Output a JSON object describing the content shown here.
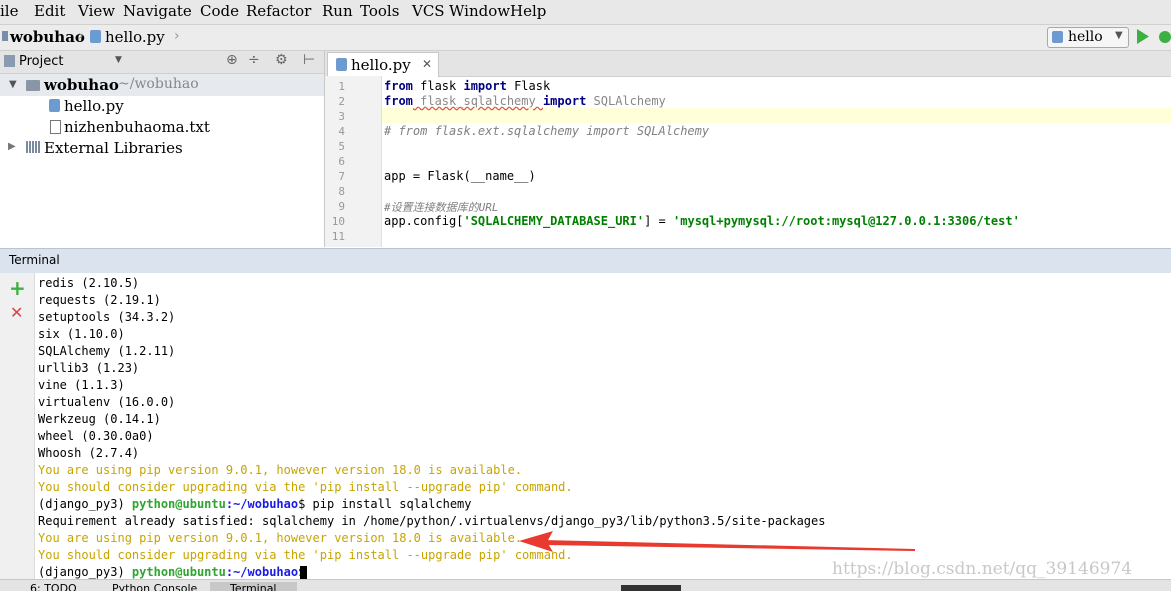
{
  "menu": [
    "ile",
    "Edit",
    "View",
    "Navigate",
    "Code",
    "Refactor",
    "Run",
    "Tools",
    "VCS",
    "Window",
    "Help"
  ],
  "nav": {
    "project": "wobuhao",
    "file": "hello.py",
    "run_config": "hello"
  },
  "project_panel": {
    "title": "Project",
    "root_name": "wobuhao",
    "root_path": "~/wobuhao",
    "files": [
      "hello.py",
      "nizhenbuhaoma.txt"
    ],
    "external": "External Libraries"
  },
  "editor": {
    "tab": "hello.py",
    "line_numbers": [
      "1",
      "2",
      "3",
      "4",
      "5",
      "6",
      "7",
      "8",
      "9",
      "10",
      "11"
    ],
    "lines": {
      "l1_kw1": "from",
      "l1_mod": " flask ",
      "l1_kw2": "import",
      "l1_name": " Flask",
      "l2_kw1": "from",
      "l2_mod": " flask_sqlalchemy ",
      "l2_kw2": "import",
      "l2_name": " SQLAlchemy",
      "l4": "# from flask.ext.sqlalchemy import SQLAlchemy",
      "l7": "app = Flask(__name__)",
      "l9": "#设置连接数据库的URL",
      "l10_a": "app.config[",
      "l10_key": "'SQLALCHEMY_DATABASE_URI'",
      "l10_b": "] = ",
      "l10_val": "'mysql+pymysql://root:mysql@127.0.0.1:3306/test'"
    }
  },
  "terminal": {
    "title": "Terminal",
    "packages": [
      "redis (2.10.5)",
      "requests (2.19.1)",
      "setuptools (34.3.2)",
      "six (1.10.0)",
      "SQLAlchemy (1.2.11)",
      "urllib3 (1.23)",
      "vine (1.1.3)",
      "virtualenv (16.0.0)",
      "Werkzeug (0.14.1)",
      "wheel (0.30.0a0)",
      "Whoosh (2.7.4)"
    ],
    "warn1": "You are using pip version 9.0.1, however version 18.0 is available.",
    "warn2": "You should consider upgrading via the 'pip install --upgrade pip' command.",
    "prompt_env": "(django_py3) ",
    "prompt_user": "python@ubuntu",
    "prompt_path": ":~/wobuhao",
    "prompt_dollar": "$ ",
    "command": "pip install sqlalchemy",
    "satisfied": "Requirement already satisfied: sqlalchemy in /home/python/.virtualenvs/django_py3/lib/python3.5/site-packages",
    "warn3": "You are using pip version 9.0.1, however version 18.0 is available.",
    "warn4": "You should consider upgrading via the 'pip install --upgrade pip' command."
  },
  "bottom_tabs": [
    "6: TODO",
    "Python Console",
    "Terminal"
  ],
  "watermark": "https://blog.csdn.net/qq_39146974",
  "colors": {
    "warning_text": "#c7a400",
    "arrow": "#e83a2e",
    "prompt_user": "#2ea52e",
    "prompt_path": "#1a1ae6"
  }
}
